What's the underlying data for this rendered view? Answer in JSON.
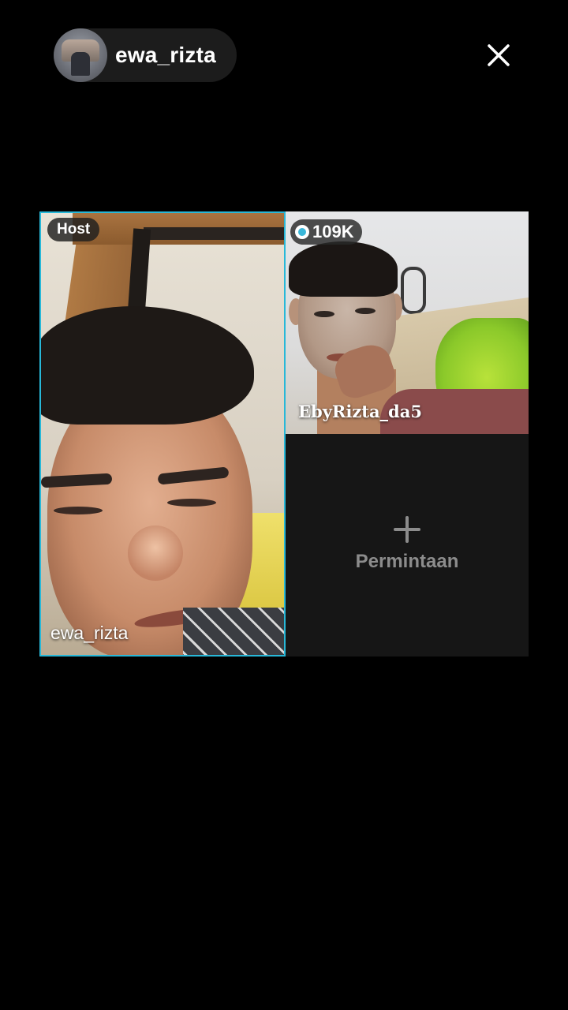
{
  "header": {
    "username": "ewa_rizta",
    "avatar_icon": "user-avatar-photo",
    "close_icon": "close-icon"
  },
  "host_tile": {
    "badge": "Host",
    "name": "ewa_rizta",
    "border_color": "#28b8d8"
  },
  "guest_tile": {
    "viewer_count": "109K",
    "name": "EbyRizta_da5",
    "viewer_icon": "live-dot-icon"
  },
  "request_tile": {
    "icon": "plus-icon",
    "label": "Permintaan"
  },
  "colors": {
    "background": "#000000",
    "accent": "#28b8d8",
    "pill_bg": "#1c1c1c",
    "request_bg": "#161616",
    "muted_text": "#8c8c8c"
  }
}
